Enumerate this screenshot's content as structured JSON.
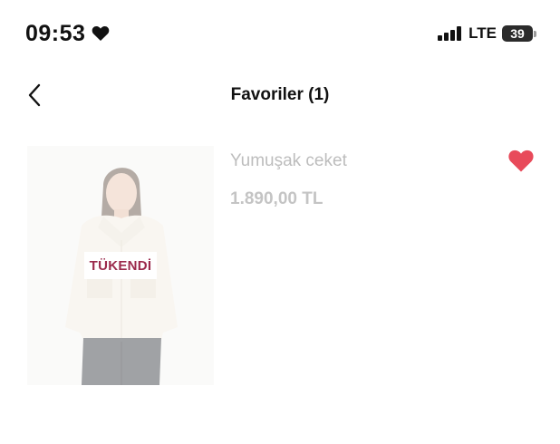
{
  "status_bar": {
    "time": "09:53",
    "network": "LTE",
    "battery": "39",
    "icons": [
      "heart-icon",
      "signal-icon",
      "battery-icon"
    ]
  },
  "nav": {
    "title": "Favoriler (1)",
    "back_icon": "chevron-left-icon"
  },
  "favorites": [
    {
      "name": "Yumuşak ceket",
      "price": "1.890,00 TL",
      "badge": "TÜKENDİ",
      "favorite_icon": "heart-filled-icon"
    }
  ],
  "colors": {
    "favorite_heart": "#e84a5a",
    "soldout_text": "#9b2a4c",
    "muted_text": "#bdbdbd"
  }
}
